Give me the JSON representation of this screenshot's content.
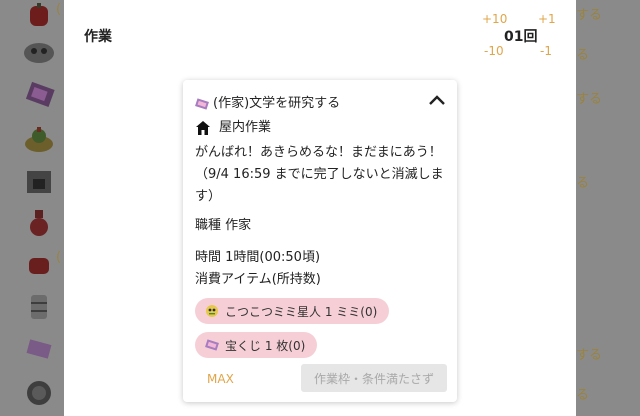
{
  "header": {
    "title": "作業",
    "count": "01回",
    "plus10": "+10",
    "plus1": "+1",
    "minus10": "-10",
    "minus1": "-1"
  },
  "background": {
    "right_text_1": "する",
    "right_text_2": "る",
    "right_text_3": "する",
    "right_text_4": "る",
    "right_text_5": "する",
    "right_text_6": "る",
    "left_marker_1": "(",
    "left_marker_2": "("
  },
  "task": {
    "title": "(作家)文学を研究する",
    "location": "屋内作業",
    "message": "がんばれ！あきらめるな！まだまにあう！（9/4 16:59 までに完了しないと消滅します）",
    "job": "職種 作家",
    "time": "時間 1時間(00:50頃)",
    "items_label": "消費アイテム(所持数)",
    "items": [
      {
        "label": "こつこつミミ星人 1 ミミ(0)",
        "icon": "alien-icon"
      },
      {
        "label": "宝くじ 1 枚(0)",
        "icon": "ticket-icon"
      }
    ],
    "max_label": "MAX",
    "submit_label": "作業枠・条件満たさず"
  },
  "colors": {
    "accent": "#e0a64a",
    "chip": "#f6cfd6",
    "disabled_bg": "#e6e6e6",
    "disabled_text": "#a8a8a8",
    "overlay": "#8a8a8a"
  }
}
